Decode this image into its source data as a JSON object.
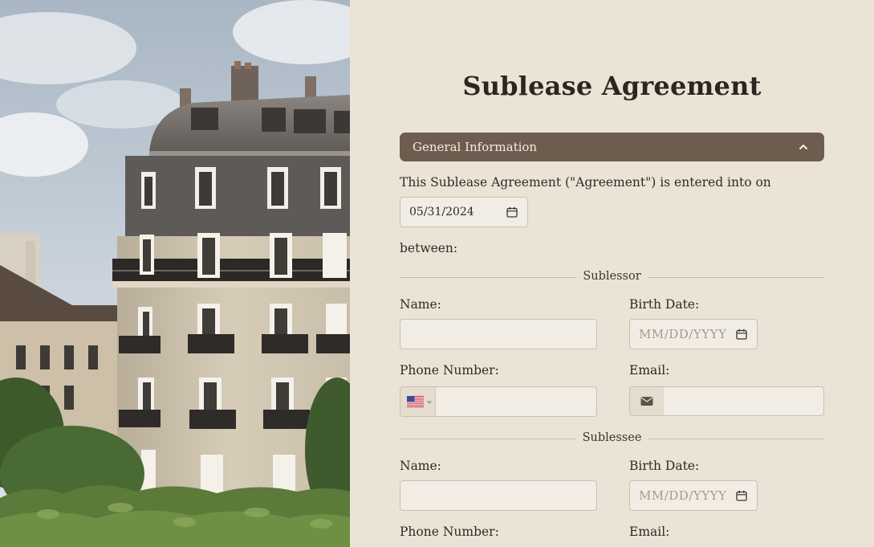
{
  "form": {
    "title": "Sublease Agreement",
    "section": {
      "label": "General Information",
      "expanded": true,
      "icon": "chevron-up-icon"
    },
    "intro_text": "This Sublease Agreement (\"Agreement\") is entered into on",
    "agreement_date": "05/31/2024",
    "between_text": "between:",
    "sublessor": {
      "heading": "Sublessor",
      "name_label": "Name:",
      "birth_label": "Birth Date:",
      "birth_placeholder": "MM/DD/YYYY",
      "phone_label": "Phone Number:",
      "email_label": "Email:"
    },
    "sublessee": {
      "heading": "Sublessee",
      "name_label": "Name:",
      "birth_label": "Birth Date:",
      "birth_placeholder": "MM/DD/YYYY",
      "phone_label": "Phone Number:",
      "email_label": "Email:"
    }
  },
  "icons": {
    "calendar": "calendar-icon",
    "flag": "us-flag-icon",
    "email": "envelope-icon"
  },
  "colors": {
    "background": "#ebe4d6",
    "section_bar": "#6d5d4f",
    "input_bg": "#f1ede5",
    "border": "#c9bfb1",
    "text": "#2f2a24"
  }
}
